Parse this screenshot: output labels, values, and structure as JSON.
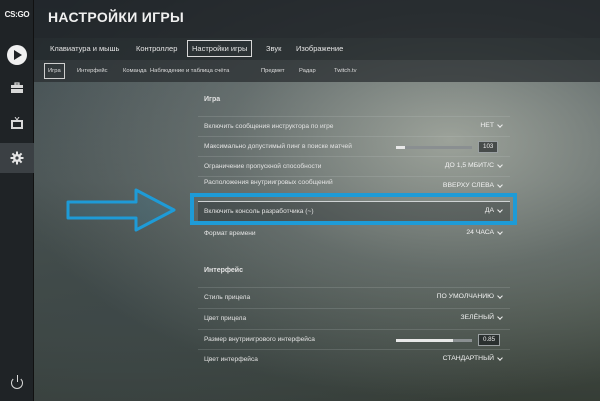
{
  "logo_text": "CS:GO",
  "page_title": "НАСТРОЙКИ ИГРЫ",
  "tabs_primary": [
    {
      "label": "Клавиатура и мышь"
    },
    {
      "label": "Контроллер"
    },
    {
      "label": "Настройки игры",
      "active": true
    },
    {
      "label": "Звук"
    },
    {
      "label": "Изображение"
    }
  ],
  "tabs_secondary": [
    {
      "label": "Игра",
      "active": true
    },
    {
      "label": "Интерфейс"
    },
    {
      "label": "Команда"
    },
    {
      "label": "Наблюдение и таблица счёта"
    },
    {
      "label": "Предмет"
    },
    {
      "label": "Радар"
    },
    {
      "label": "Twitch.tv"
    }
  ],
  "section_game": {
    "title": "Игра",
    "rows": [
      {
        "label": "Включить сообщения инструктора по игре",
        "value": "НЕТ"
      },
      {
        "label": "Максимально допустимый пинг в поиске матчей",
        "value": "103",
        "slider_fraction": 0.12
      },
      {
        "label": "Ограничение пропускной способности",
        "value": "ДО 1,5 МБИТ/С"
      },
      {
        "label": "Расположения внутриигровых сообщений",
        "value": "ВВЕРХУ СЛЕВА"
      },
      {
        "label": "Включить консоль разработчика (~)",
        "value": "ДА"
      },
      {
        "label": "Формат времени",
        "value": "24 ЧАСА"
      }
    ]
  },
  "section_interface": {
    "title": "Интерфейс",
    "rows": [
      {
        "label": "Стиль прицела",
        "value": "ПО УМОЛЧАНИЮ"
      },
      {
        "label": "Цвет прицела",
        "value": "ЗЕЛЁНЫЙ"
      },
      {
        "label": "Размер внутриигрового интерфейса",
        "value": "0.85",
        "slider_fraction": 0.75
      },
      {
        "label": "Цвет интерфейса",
        "value": "СТАНДАРТНЫЙ"
      }
    ]
  },
  "colors": {
    "highlight": "#1e9bd7",
    "sidebar": "#1f2326"
  },
  "icons": {
    "play": "play-icon",
    "briefcase": "briefcase-icon",
    "tv": "tv-icon",
    "settings": "gear-icon",
    "power": "power-icon"
  }
}
